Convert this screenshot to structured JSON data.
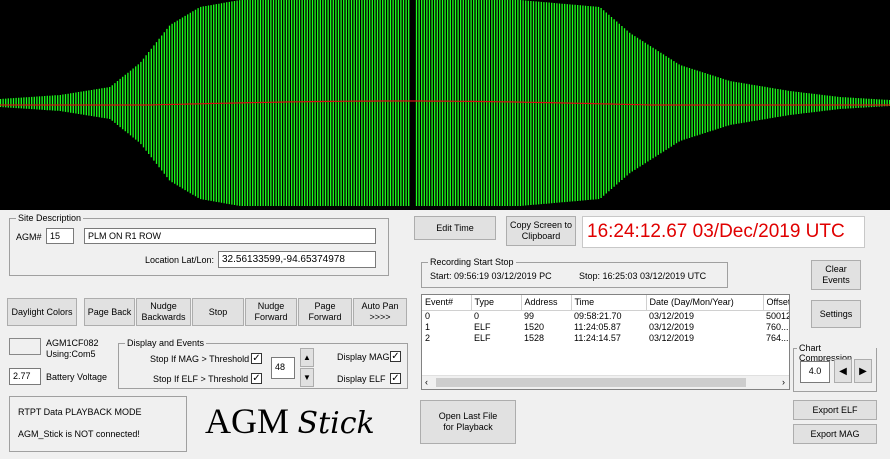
{
  "waveform": {
    "colors": {
      "background": "#000000",
      "trace": "#1cff1c",
      "midline": "#d01010"
    }
  },
  "site": {
    "group_title": "Site Description",
    "agm_label": "AGM#",
    "agm_value": "15",
    "site_name": "PLM ON R1 ROW",
    "location_label": "Location Lat/Lon:",
    "location_value": "32.56133599,-94.65374978"
  },
  "time_bar": {
    "edit_time": "Edit Time",
    "copy_screen": "Copy Screen to Clipboard",
    "clock": "16:24:12.67 03/Dec/2019 UTC",
    "clock_color": "#e00000"
  },
  "recording": {
    "group_title": "Recording Start Stop",
    "start": "Start: 09:56:19 03/12/2019 PC",
    "stop": "Stop: 16:25:03 03/12/2019 UTC"
  },
  "side_buttons": {
    "clear_events": "Clear Events",
    "settings": "Settings"
  },
  "nav_buttons": {
    "daylight": "Daylight Colors",
    "page_back": "Page Back",
    "nudge_back": "Nudge Backwards",
    "stop": "Stop",
    "nudge_forward": "Nudge Forward",
    "page_forward": "Page Forward",
    "auto_pan": "Auto Pan >>>>"
  },
  "device": {
    "id": "AGM1CF082",
    "port": "Using:Com5",
    "battery_value": "2.77",
    "battery_label": "Battery Voltage"
  },
  "display": {
    "group_title": "Display  and Events",
    "stop_mag": "Stop If MAG > Threshold",
    "stop_elf": "Stop If ELF > Threshold",
    "threshold": "48",
    "display_mag": "Display MAG",
    "display_elf": "Display ELF",
    "check_mark": "✓"
  },
  "events": {
    "columns": [
      "Event#",
      "Type",
      "Address",
      "Time",
      "Date (Day/Mon/Year)",
      "Offset"
    ],
    "rows": [
      [
        "0",
        "0",
        "99",
        "09:58:21.70",
        "03/12/2019",
        "50012"
      ],
      [
        "1",
        "ELF",
        "1520",
        "11:24:05.87",
        "03/12/2019",
        "760..."
      ],
      [
        "2",
        "ELF",
        "1528",
        "11:24:14.57",
        "03/12/2019",
        "764..."
      ]
    ]
  },
  "compression": {
    "group_title": "Chart Compression",
    "value": "4.0"
  },
  "status": {
    "mode": "RTPT Data PLAYBACK MODE",
    "connection": "AGM_Stick is NOT connected!"
  },
  "logo": {
    "agm": "AGM",
    "stick": "Stick"
  },
  "file": {
    "open_last": "Open Last File for Playback",
    "export_elf": "Export ELF",
    "export_mag": "Export MAG"
  }
}
